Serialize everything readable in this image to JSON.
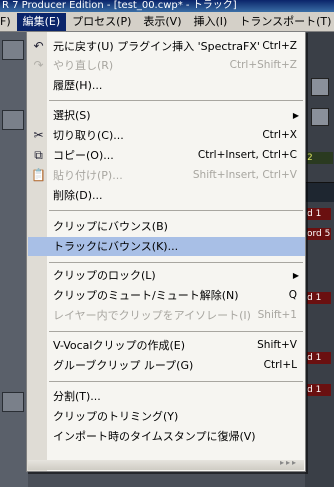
{
  "window": {
    "title": "R 7 Producer Edition - [test_00.cwp* - トラック]"
  },
  "menubar": [
    {
      "label": "F)"
    },
    {
      "label": "編集(E)"
    },
    {
      "label": "プロセス(P)"
    },
    {
      "label": "表示(V)"
    },
    {
      "label": "挿入(I)"
    },
    {
      "label": "トランスポート(T)"
    }
  ],
  "background": {
    "right_clips": [
      "d 1",
      "ord 5",
      "d 1",
      "d 1",
      "d 1"
    ],
    "right_markers": [
      "2"
    ]
  },
  "menu": {
    "items": [
      {
        "label": "元に戻す(U) プラグイン挿入 'SpectraFX'",
        "shortcut": "Ctrl+Z",
        "icon": "undo-icon",
        "glyph": "↶",
        "disabled": false
      },
      {
        "label": "やり直し(R)",
        "shortcut": "Ctrl+Shift+Z",
        "icon": "redo-icon",
        "glyph": "↷",
        "disabled": true
      },
      {
        "label": "履歴(H)...",
        "shortcut": "",
        "disabled": false
      },
      {
        "label": "選択(S)",
        "shortcut": "",
        "submenu": true,
        "disabled": false
      },
      {
        "label": "切り取り(C)...",
        "shortcut": "Ctrl+X",
        "icon": "scissors-icon",
        "glyph": "✂",
        "disabled": false
      },
      {
        "label": "コピー(O)...",
        "shortcut": "Ctrl+Insert, Ctrl+C",
        "icon": "copy-icon",
        "glyph": "⧉",
        "disabled": false
      },
      {
        "label": "貼り付け(P)...",
        "shortcut": "Shift+Insert, Ctrl+V",
        "icon": "paste-icon",
        "glyph": "📋",
        "disabled": true
      },
      {
        "label": "削除(D)...",
        "shortcut": "",
        "disabled": false
      },
      {
        "label": "クリップにバウンス(B)",
        "shortcut": "",
        "disabled": false
      },
      {
        "label": "トラックにバウンス(K)...",
        "shortcut": "",
        "disabled": false,
        "highlight": true
      },
      {
        "label": "クリップのロック(L)",
        "shortcut": "",
        "submenu": true,
        "disabled": false
      },
      {
        "label": "クリップのミュート/ミュート解除(N)",
        "shortcut": "Q",
        "disabled": false
      },
      {
        "label": "レイヤー内でクリップをアイソレート(I)",
        "shortcut": "Shift+1",
        "disabled": true
      },
      {
        "label": "V-Vocalクリップの作成(E)",
        "shortcut": "Shift+V",
        "disabled": false
      },
      {
        "label": "グルーブクリップ ループ(G)",
        "shortcut": "Ctrl+L",
        "disabled": false
      },
      {
        "label": "分割(T)...",
        "shortcut": "",
        "disabled": false
      },
      {
        "label": "クリップのトリミング(Y)",
        "shortcut": "",
        "disabled": false
      },
      {
        "label": "インポート時のタイムスタンプに復帰(V)",
        "shortcut": "",
        "disabled": false
      }
    ],
    "submenu_arrow": "▶",
    "footer_chevron": "▸▸▸"
  },
  "colors": {
    "menu_bg": "#f6f5f1",
    "highlight": "#a8bfe6",
    "disabled_text": "#a8a6a0"
  }
}
